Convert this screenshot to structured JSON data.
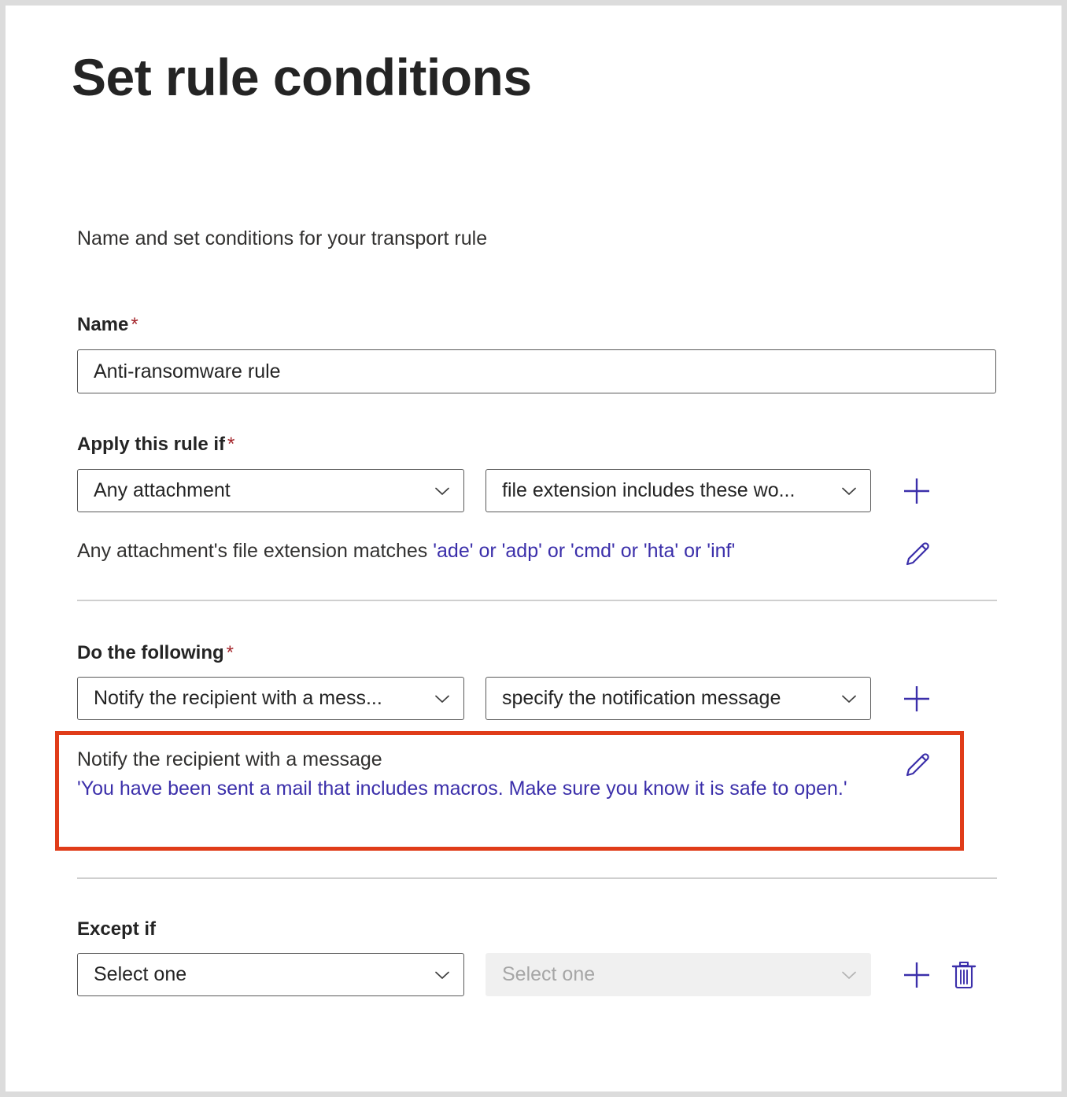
{
  "page": {
    "title": "Set rule conditions",
    "subtitle": "Name and set conditions for your transport rule"
  },
  "name_field": {
    "label": "Name",
    "required_marker": "*",
    "value": "Anti-ransomware rule",
    "placeholder": "Anti-ransomware rule"
  },
  "apply_rule_if": {
    "label": "Apply this rule if",
    "required_marker": "*",
    "condition_select": {
      "value": "Any attachment",
      "options": [
        "Any attachment"
      ]
    },
    "operator_select": {
      "value": "file extension includes these wo...",
      "options": [
        "file extension includes these words"
      ]
    },
    "add_button_label": "+",
    "summary_prefix": "Any attachment's file extension matches ",
    "summary_values": "'ade' or 'adp' or 'cmd' or 'hta' or 'inf'"
  },
  "do_the_following": {
    "label": "Do the following",
    "required_marker": "*",
    "action_select": {
      "value": "Notify the recipient with a mess...",
      "options": [
        "Notify the recipient with a message"
      ]
    },
    "param_select": {
      "value": "specify the notification message",
      "options": [
        "specify the notification message"
      ]
    },
    "add_button_label": "+",
    "summary_line1": "Notify the recipient with a message",
    "summary_line2": "'You have been sent a mail that includes macros. Make sure you know it is safe to open.'"
  },
  "except_if": {
    "label": "Except if",
    "exception_select": {
      "value": "Select one",
      "options": [
        "Select one"
      ]
    },
    "exception_param_select": {
      "value": "Select one",
      "options": [
        "Select one"
      ],
      "disabled": true
    },
    "add_button_label": "+",
    "delete_button_label": "Delete"
  },
  "colors": {
    "accent_purple": "#3b2faa",
    "required_red": "#a4262c",
    "highlight_red": "#e03c19",
    "text_primary": "#242424",
    "border_gray": "#595959",
    "divider_gray": "#cfcfcf",
    "disabled_bg": "#f0f0f0"
  },
  "icons": {
    "chevron_down": "chevron-down-icon",
    "plus": "plus-icon",
    "pencil": "pencil-icon",
    "trash": "trash-icon"
  }
}
